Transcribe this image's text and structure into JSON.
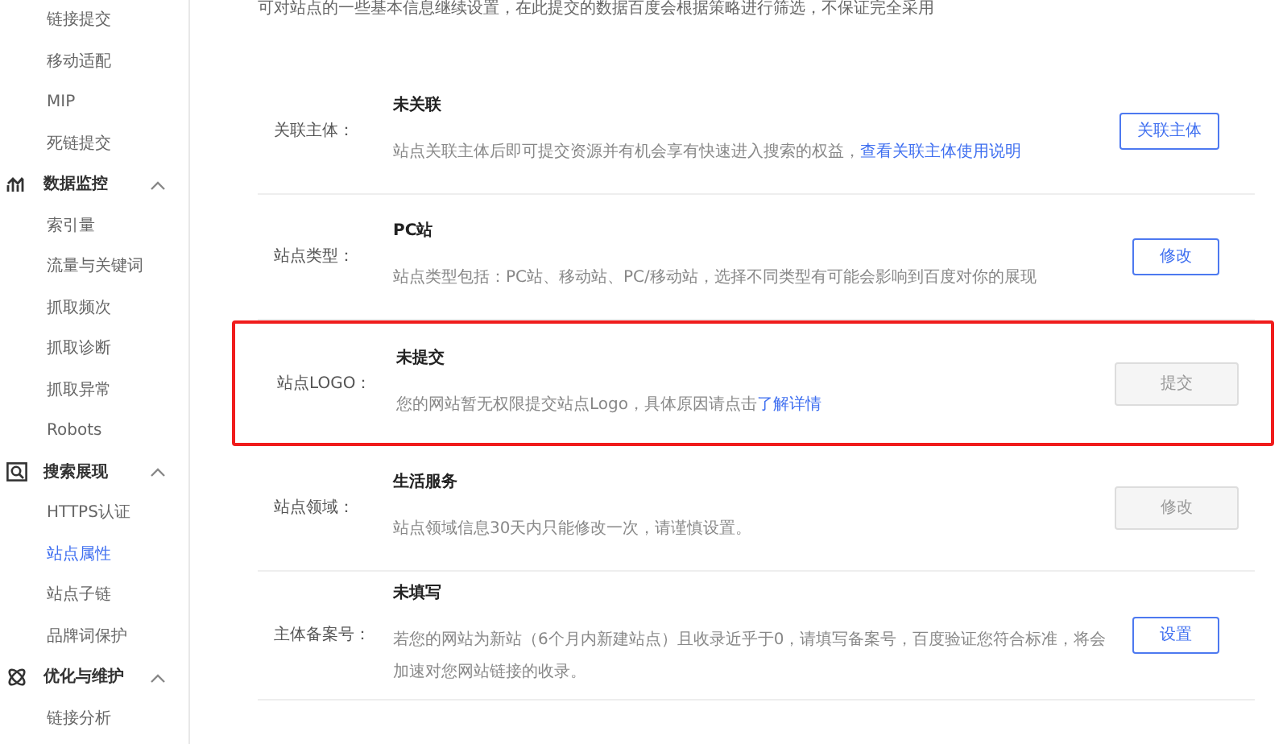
{
  "sidebar": {
    "items": [
      {
        "kind": "item",
        "label": "链接提交",
        "selected": false
      },
      {
        "kind": "item",
        "label": "移动适配",
        "selected": false
      },
      {
        "kind": "item",
        "label": "MIP",
        "selected": false
      },
      {
        "kind": "item",
        "label": "死链提交",
        "selected": false
      },
      {
        "kind": "group",
        "label": "数据监控",
        "expanded": true
      },
      {
        "kind": "item",
        "label": "索引量",
        "selected": false
      },
      {
        "kind": "item",
        "label": "流量与关键词",
        "selected": false
      },
      {
        "kind": "item",
        "label": "抓取频次",
        "selected": false
      },
      {
        "kind": "item",
        "label": "抓取诊断",
        "selected": false
      },
      {
        "kind": "item",
        "label": "抓取异常",
        "selected": false
      },
      {
        "kind": "item",
        "label": "Robots",
        "selected": false
      },
      {
        "kind": "group",
        "label": "搜索展现",
        "expanded": true
      },
      {
        "kind": "item",
        "label": "HTTPS认证",
        "selected": false
      },
      {
        "kind": "item",
        "label": "站点属性",
        "selected": true
      },
      {
        "kind": "item",
        "label": "站点子链",
        "selected": false
      },
      {
        "kind": "item",
        "label": "品牌词保护",
        "selected": false
      },
      {
        "kind": "group",
        "label": "优化与维护",
        "expanded": true
      },
      {
        "kind": "item",
        "label": "链接分析",
        "selected": false
      }
    ]
  },
  "intro": "可对站点的一些基本信息继续设置，在此提交的数据百度会根据策略进行筛选，不保证完全采用",
  "rows": [
    {
      "label": "关联主体：",
      "value": "未关联",
      "description": "站点关联主体后即可提交资源并有机会享有快速进入搜索的权益，",
      "link": "查看关联主体使用说明",
      "button": {
        "label": "关联主体",
        "disabled": false
      },
      "highlighted": false
    },
    {
      "label": "站点类型：",
      "value": "PC站",
      "description": "站点类型包括：PC站、移动站、PC/移动站，选择不同类型有可能会影响到百度对你的展现",
      "button": {
        "label": "修改",
        "disabled": false
      },
      "highlighted": false
    },
    {
      "label": "站点LOGO：",
      "value": "未提交",
      "description": "您的网站暂无权限提交站点Logo，具体原因请点击",
      "link": "了解详情",
      "button": {
        "label": "提交",
        "disabled": true
      },
      "highlighted": true
    },
    {
      "label": "站点领域：",
      "value": "生活服务",
      "description": "站点领域信息30天内只能修改一次，请谨慎设置。",
      "button": {
        "label": "修改",
        "disabled": true
      },
      "highlighted": false
    },
    {
      "label": "主体备案号：",
      "value": "未填写",
      "description": "若您的网站为新站（6个月内新建站点）且收录近乎于0，请填写备案号，百度验证您符合标准，将会加速对您网站链接的收录。",
      "button": {
        "label": "设置",
        "disabled": false
      },
      "highlighted": false
    }
  ]
}
